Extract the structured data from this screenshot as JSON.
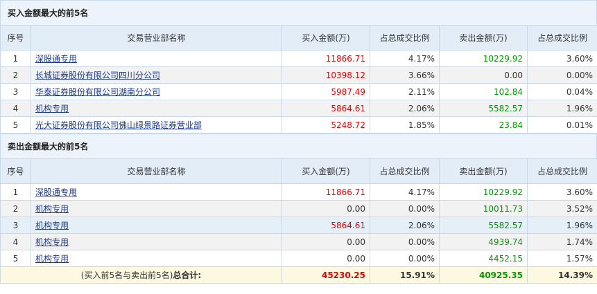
{
  "colors": {
    "buy": "#e60000",
    "sell": "#009900",
    "link": "#1a3a8c"
  },
  "headers": [
    "序号",
    "交易营业部名称",
    "买入金额(万)",
    "占总成交比例",
    "卖出金额(万)",
    "占总成交比例"
  ],
  "buy_section": {
    "title": "买入金额最大的前5名",
    "rows": [
      {
        "no": "1",
        "name": "深股通专用",
        "buy": "11866.71",
        "buy_pct": "4.17%",
        "sell": "10229.92",
        "sell_pct": "3.60%"
      },
      {
        "no": "2",
        "name": "长城证券股份有限公司四川分公司",
        "buy": "10398.12",
        "buy_pct": "3.66%",
        "sell": "0.00",
        "sell_pct": "0.00%"
      },
      {
        "no": "3",
        "name": "华泰证券股份有限公司湖南分公司",
        "buy": "5987.49",
        "buy_pct": "2.11%",
        "sell": "102.84",
        "sell_pct": "0.04%"
      },
      {
        "no": "4",
        "name": "机构专用",
        "buy": "5864.61",
        "buy_pct": "2.06%",
        "sell": "5582.57",
        "sell_pct": "1.96%"
      },
      {
        "no": "5",
        "name": "光大证券股份有限公司佛山绿景路证券营业部",
        "buy": "5248.72",
        "buy_pct": "1.85%",
        "sell": "23.84",
        "sell_pct": "0.01%"
      }
    ]
  },
  "sell_section": {
    "title": "卖出金额最大的前5名",
    "rows": [
      {
        "no": "1",
        "name": "深股通专用",
        "buy": "11866.71",
        "buy_pct": "4.17%",
        "sell": "10229.92",
        "sell_pct": "3.60%"
      },
      {
        "no": "2",
        "name": "机构专用",
        "buy": "0.00",
        "buy_pct": "0.00%",
        "sell": "10011.73",
        "sell_pct": "3.52%"
      },
      {
        "no": "3",
        "name": "机构专用",
        "buy": "5864.61",
        "buy_pct": "2.06%",
        "sell": "5582.57",
        "sell_pct": "1.96%"
      },
      {
        "no": "4",
        "name": "机构专用",
        "buy": "0.00",
        "buy_pct": "0.00%",
        "sell": "4939.74",
        "sell_pct": "1.74%"
      },
      {
        "no": "5",
        "name": "机构专用",
        "buy": "0.00",
        "buy_pct": "0.00%",
        "sell": "4452.15",
        "sell_pct": "1.57%"
      }
    ]
  },
  "total": {
    "label_prefix": "(买入前5名与卖出前5名)",
    "label_bold": "总合计:",
    "buy": "45230.25",
    "buy_pct": "15.91%",
    "sell": "40925.35",
    "sell_pct": "14.39%"
  }
}
